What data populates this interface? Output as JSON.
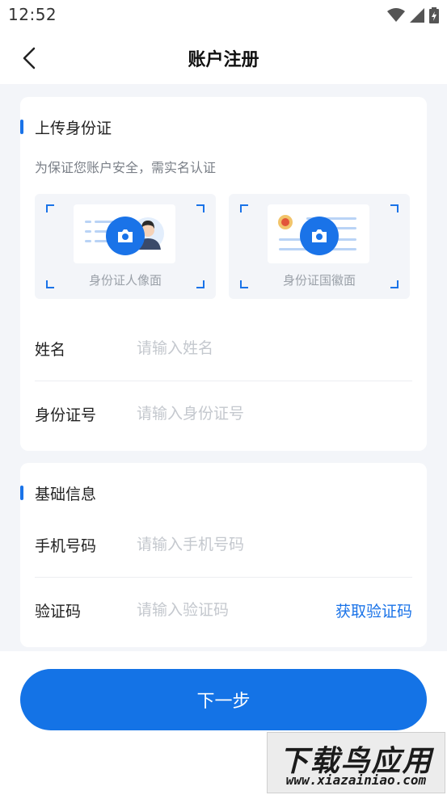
{
  "status_bar": {
    "time": "12:52",
    "icons": [
      "wifi-icon",
      "signal-icon",
      "battery-charging-icon"
    ]
  },
  "nav": {
    "back_icon": "chevron-left-icon",
    "title": "账户注册"
  },
  "id_section": {
    "title": "上传身份证",
    "subtitle": "为保证您账户安全，需实名认证",
    "front_label": "身份证人像面",
    "back_label": "身份证国徽面",
    "fields": [
      {
        "label": "姓名",
        "placeholder": "请输入姓名",
        "value": ""
      },
      {
        "label": "身份证号",
        "placeholder": "请输入身份证号",
        "value": ""
      }
    ]
  },
  "basic_section": {
    "title": "基础信息",
    "fields": [
      {
        "label": "手机号码",
        "placeholder": "请输入手机号码",
        "value": ""
      },
      {
        "label": "验证码",
        "placeholder": "请输入验证码",
        "value": ""
      }
    ],
    "get_code_label": "获取验证码"
  },
  "actions": {
    "next_label": "下一步"
  },
  "watermark": {
    "main": "下载鸟应用",
    "url": "www.xiazainiao.com"
  },
  "colors": {
    "accent": "#1a73e8",
    "background": "#f3f5f9",
    "placeholder": "#c4c8ce"
  }
}
